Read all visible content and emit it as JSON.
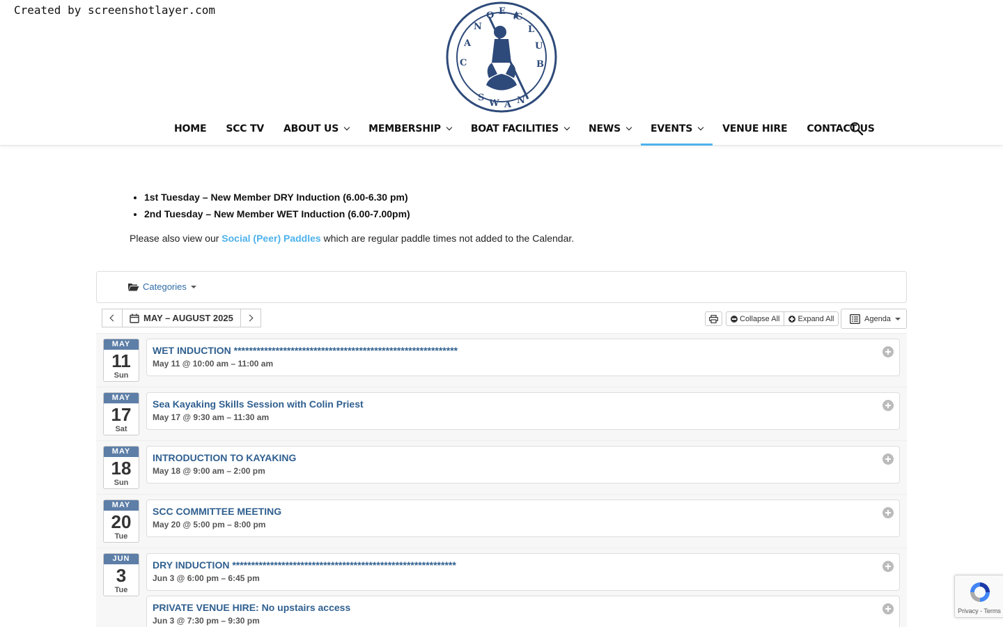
{
  "watermark": "Created by screenshotlayer.com",
  "logo": {
    "alt": "Swan Canoe Club logo",
    "top_text": "C·A·N·O·E  C·L·U·B",
    "bottom_text": "S·W·A·N"
  },
  "nav": {
    "items": [
      {
        "label": "HOME",
        "dropdown": false
      },
      {
        "label": "SCC TV",
        "dropdown": false
      },
      {
        "label": "ABOUT US",
        "dropdown": true
      },
      {
        "label": "MEMBERSHIP",
        "dropdown": true
      },
      {
        "label": "BOAT FACILITIES",
        "dropdown": true
      },
      {
        "label": "NEWS",
        "dropdown": true
      },
      {
        "label": "EVENTS",
        "dropdown": true,
        "active": true
      },
      {
        "label": "VENUE HIRE",
        "dropdown": false
      },
      {
        "label": "CONTACT US",
        "dropdown": false
      }
    ],
    "search_icon": "search-icon",
    "active_color": "#4db2ec"
  },
  "content": {
    "bullets": [
      "1st Tuesday – New Member DRY Induction (6.00-6.30 pm)",
      "2nd Tuesday – New Member WET Induction (6.00-7.00pm)"
    ],
    "note_before": "Please also view our ",
    "note_link": "Social (Peer) Paddles",
    "note_after": " which are regular paddle times not added to the Calendar."
  },
  "calendar": {
    "categories_label": "Categories",
    "range_label": "MAY – AUGUST 2025",
    "collapse_label": "Collapse All",
    "expand_label": "Expand All",
    "view_label": "Agenda",
    "date_color": "#5d7ea7",
    "days": [
      {
        "month": "MAY",
        "day": "11",
        "dow": "Sun",
        "events": [
          {
            "title": "WET INDUCTION ***********************************************************",
            "time": "May 11 @ 10:00 am – 11:00 am"
          }
        ]
      },
      {
        "month": "MAY",
        "day": "17",
        "dow": "Sat",
        "events": [
          {
            "title": "Sea Kayaking Skills Session with Colin Priest",
            "time": "May 17 @ 9:30 am – 11:30 am"
          }
        ]
      },
      {
        "month": "MAY",
        "day": "18",
        "dow": "Sun",
        "events": [
          {
            "title": "INTRODUCTION TO KAYAKING",
            "time": "May 18 @ 9:00 am – 2:00 pm"
          }
        ]
      },
      {
        "month": "MAY",
        "day": "20",
        "dow": "Tue",
        "events": [
          {
            "title": "SCC COMMITTEE MEETING",
            "time": "May 20 @ 5:00 pm – 8:00 pm"
          }
        ]
      },
      {
        "month": "JUN",
        "day": "3",
        "dow": "Tue",
        "events": [
          {
            "title": "DRY INDUCTION ***********************************************************",
            "time": "Jun 3 @ 6:00 pm – 6:45 pm"
          },
          {
            "title": "PRIVATE VENUE HIRE: No upstairs access",
            "time": "Jun 3 @ 7:30 pm – 9:30 pm"
          }
        ]
      }
    ]
  },
  "recaptcha": {
    "text": "Privacy - Terms"
  }
}
